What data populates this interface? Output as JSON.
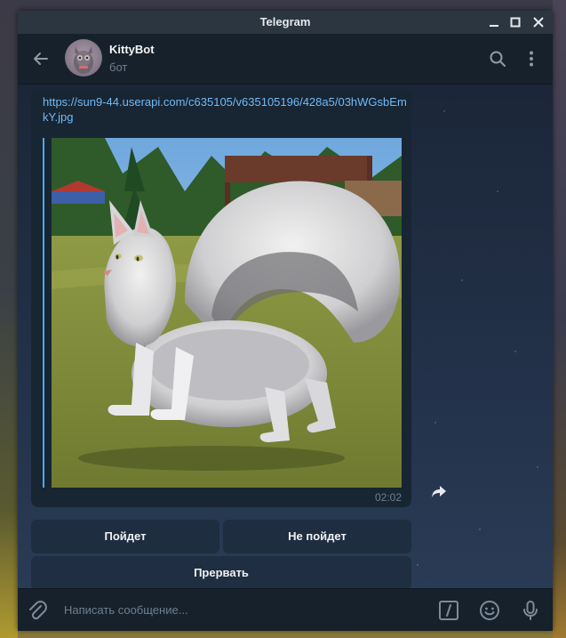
{
  "window": {
    "title": "Telegram"
  },
  "header": {
    "name": "KittyBot",
    "status": "бот"
  },
  "message": {
    "link": "https://sun9-44.userapi.com/c635105/v635105196/428a5/03hWGsbEmkY.jpg",
    "time": "02:02"
  },
  "keyboard": {
    "buttons": [
      {
        "label": "Пойдет"
      },
      {
        "label": "Не пойдет"
      },
      {
        "label": "Прервать"
      }
    ]
  },
  "composer": {
    "placeholder": "Написать сообщение..."
  },
  "colors": {
    "accent": "#4da8e8",
    "link": "#71baf5",
    "window_bg": "#17212b",
    "bubble_bg": "#182533"
  },
  "icons": {
    "back": "arrow-left-icon",
    "search": "search-icon",
    "menu": "more-vertical-icon",
    "share": "share-icon",
    "attach": "paperclip-icon",
    "commands": "slash-command-icon",
    "emoji": "smile-icon",
    "mic": "microphone-icon"
  }
}
